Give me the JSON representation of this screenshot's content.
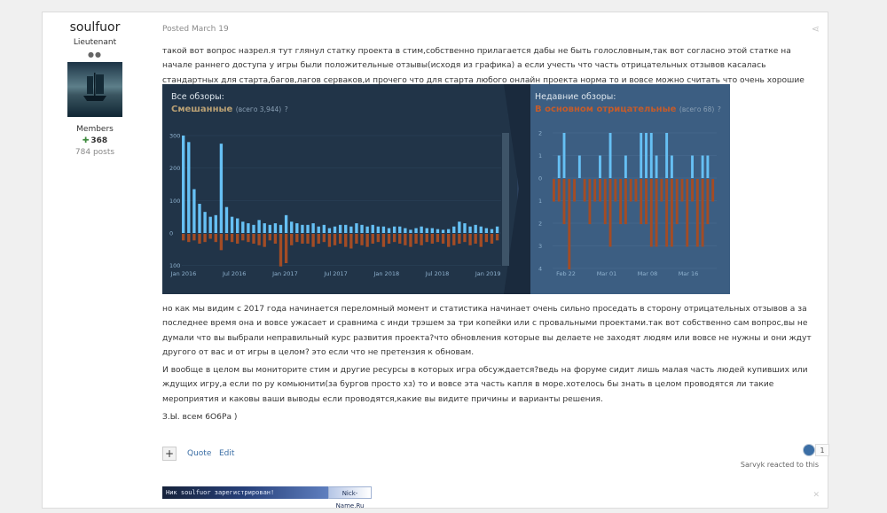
{
  "author": {
    "name": "soulfuor",
    "rank": "Lieutenant",
    "group": "Members",
    "reputation": "368",
    "posts": "784 posts"
  },
  "post": {
    "posted": "Posted March 19",
    "para1": "такой вот вопрос назрел.я тут глянул статку проекта в стим,собственно прилагается дабы не быть голословным,так вот согласно этой статке на начале раннего доступа у игры были положительные отзывы(исходя из графика) а если учесть что часть отрицательных отзывов касалась стандартных для старта,багов,лагов серваков,и прочего что для старта любого онлайн проекта норма то и вовсе можно считать что очень хорошие отзывы",
    "para2": "но как мы видим с 2017 года начинается переломный момент и статистика начинает очень сильно проседать в сторону отрицательных отзывов а за последнее время она и вовсе ужасает и сравнима с инди трэшем за три копейки или с провальными проектами.так вот собственно сам вопрос,вы не думали что вы выбрали неправильный курс развития проекта?что обновления которые вы делаете не заходят людям или вовсе не нужны и они ждут другого от вас и от игры в целом? это если что не претензия к обновам.",
    "para3": "И  вообще в целом вы мониторите стим и другие ресурсы в которых игра обсуждается?ведь на форуме  сидит лишь малая часть людей купивших или ждущих игру,а если по ру комьюнити(за бургов просто хз) то и вовсе эта часть капля в море.хотелось бы знать в целом проводятся ли такие мероприятия и каковы ваши выводы если проводятся,какие вы видите причины и варианты решения.",
    "para4": "З.Ы. всем 6О6Ра )"
  },
  "chart": {
    "left_title": "Все обзоры:",
    "left_rating": "Смешанные",
    "left_count": "(всего 3,944)",
    "right_title": "Недавние обзоры:",
    "right_rating": "В основном отрицательные",
    "right_count": "(всего 68)",
    "help_glyph": "?",
    "colors": {
      "positive": "#66c0f4",
      "negative": "#a34c25",
      "rating_left": "#b9a074",
      "rating_right": "#c35c2c"
    }
  },
  "chart_data": [
    {
      "type": "bar",
      "title": "Все обзоры:",
      "y_ticks": [
        "300",
        "200",
        "100",
        "0",
        "100"
      ],
      "x_ticks": [
        "Jan 2016",
        "Jul 2016",
        "Jan 2017",
        "Jul 2017",
        "Jan 2018",
        "Jul 2018",
        "Jan 2019"
      ],
      "ylim": [
        -100,
        300
      ],
      "series": [
        {
          "values": [
            300,
            280,
            135,
            90,
            65,
            50,
            55,
            275,
            80,
            50,
            45,
            35,
            30,
            25,
            40,
            30,
            25,
            30,
            25,
            55,
            35,
            30,
            25,
            25,
            30,
            20,
            25,
            15,
            20,
            25,
            25,
            20,
            30,
            25,
            20,
            25,
            20,
            20,
            15,
            20,
            20,
            15,
            10,
            15,
            20,
            15,
            15,
            12,
            10,
            12,
            20,
            35,
            30,
            20,
            25,
            20,
            15,
            12,
            20
          ]
        },
        {
          "values": [
            -20,
            -25,
            -20,
            -30,
            -25,
            -15,
            -25,
            -50,
            -20,
            -25,
            -30,
            -20,
            -25,
            -30,
            -35,
            -40,
            -20,
            -30,
            -100,
            -90,
            -35,
            -25,
            -30,
            -30,
            -40,
            -30,
            -25,
            -40,
            -35,
            -30,
            -40,
            -45,
            -30,
            -35,
            -40,
            -30,
            -25,
            -40,
            -30,
            -25,
            -30,
            -35,
            -40,
            -30,
            -35,
            -25,
            -30,
            -25,
            -30,
            -40,
            -35,
            -30,
            -25,
            -35,
            -30,
            -40,
            -25,
            -30,
            -20
          ]
        }
      ]
    },
    {
      "type": "bar",
      "title": "Недавние обзоры:",
      "y_ticks": [
        "2",
        "1",
        "0",
        "1",
        "2",
        "3",
        "4"
      ],
      "x_ticks": [
        "Feb 22",
        "Mar 01",
        "Mar 08",
        "Mar 16"
      ],
      "ylim": [
        -4,
        2
      ],
      "series": [
        {
          "values": [
            0,
            1,
            2,
            0,
            0,
            1,
            0,
            0,
            0,
            1,
            0,
            2,
            0,
            0,
            1,
            0,
            0,
            2,
            2,
            2,
            1,
            0,
            2,
            1,
            0,
            0,
            0,
            1,
            0,
            1,
            1,
            0
          ]
        },
        {
          "values": [
            -1,
            -1,
            -2,
            -4,
            -1,
            0,
            -1,
            -2,
            -1,
            -1,
            -2,
            -3,
            -1,
            -2,
            -2,
            -1,
            -1,
            -2,
            -2,
            -3,
            -3,
            -1,
            -3,
            -3,
            -2,
            -1,
            -3,
            -1,
            -3,
            -3,
            -2,
            -1
          ]
        }
      ]
    }
  ],
  "actions": {
    "plus": "+",
    "quote": "Quote",
    "edit": "Edit",
    "react_count": "1",
    "react_text": "Sarvyk reacted to this"
  },
  "signature": {
    "left": "Ник soulfuor зарегистрирован!",
    "right": "Nick-Name.Ru"
  }
}
